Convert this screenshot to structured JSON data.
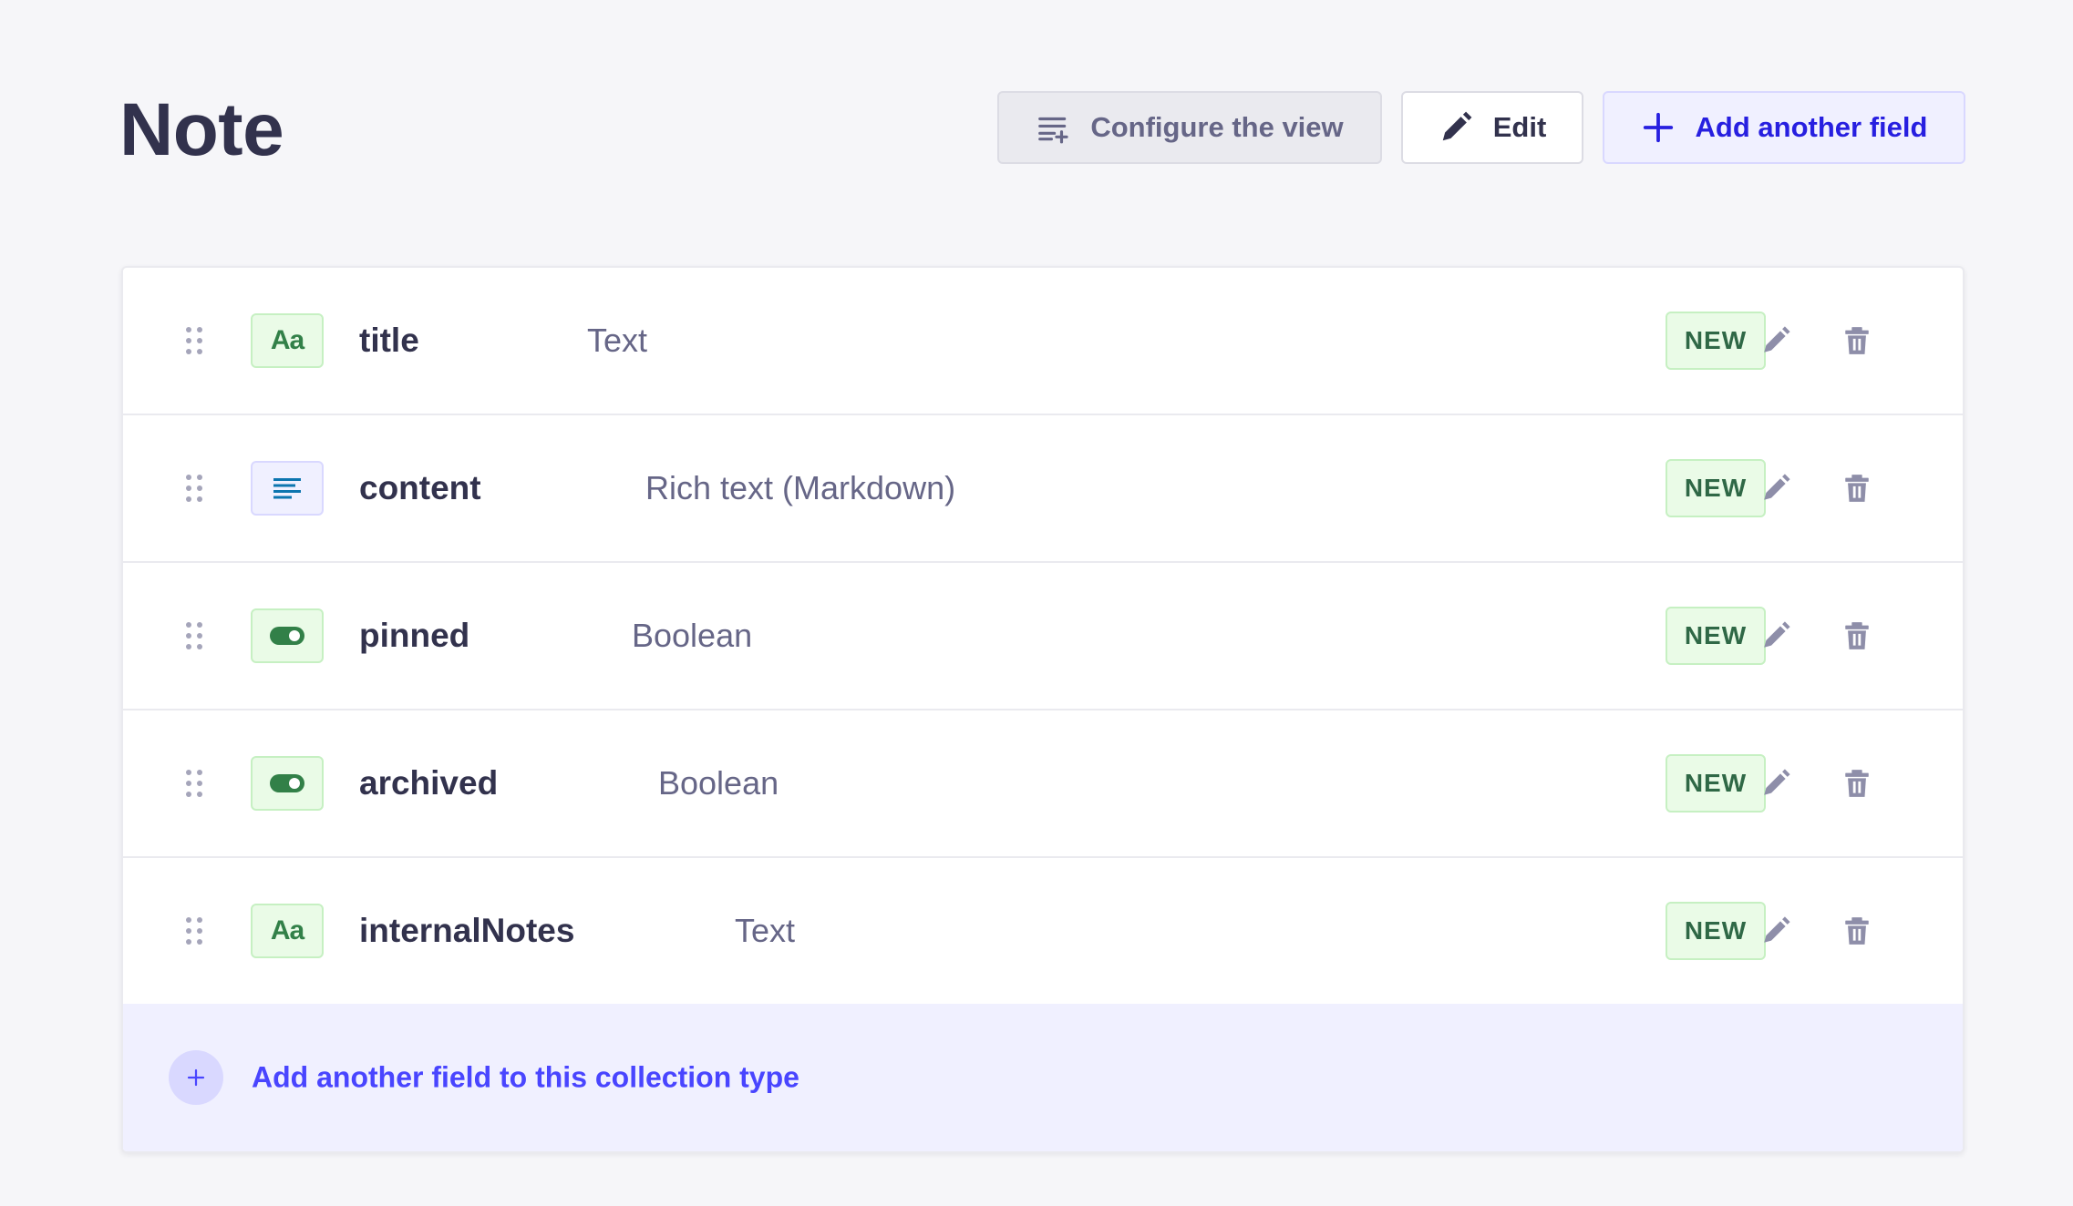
{
  "header": {
    "title": "Note",
    "configure_label": "Configure the view",
    "edit_label": "Edit",
    "add_field_label": "Add another field"
  },
  "fields": [
    {
      "name": "title",
      "type": "Text",
      "badge": "NEW",
      "icon": "text-aa-icon"
    },
    {
      "name": "content",
      "type": "Rich text (Markdown)",
      "badge": "NEW",
      "icon": "rich-text-icon"
    },
    {
      "name": "pinned",
      "type": "Boolean",
      "badge": "NEW",
      "icon": "boolean-toggle-icon"
    },
    {
      "name": "archived",
      "type": "Boolean",
      "badge": "NEW",
      "icon": "boolean-toggle-icon"
    },
    {
      "name": "internalNotes",
      "type": "Text",
      "badge": "NEW",
      "icon": "text-aa-icon"
    }
  ],
  "icons": {
    "aa_text": "Aa"
  },
  "footer": {
    "add_label": "Add another field to this collection type"
  },
  "colors": {
    "primary": "#4945ff",
    "success": "#328048",
    "text": "#32324d",
    "muted": "#666687"
  }
}
